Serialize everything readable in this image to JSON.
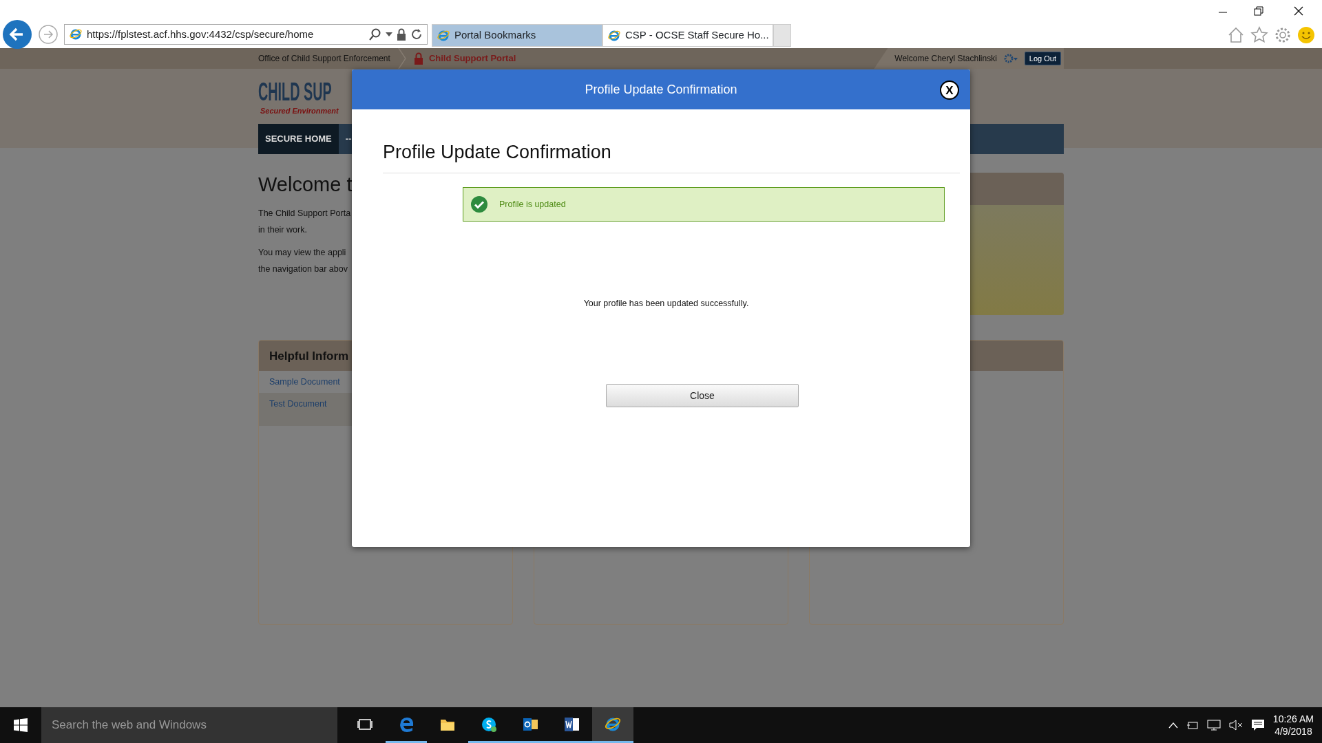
{
  "browser": {
    "address": "https://fplstest.acf.hhs.gov:4432/csp/secure/home",
    "tabs": [
      {
        "title": "Portal Bookmarks",
        "selected": false
      },
      {
        "title": "CSP - OCSE Staff Secure Ho...",
        "selected": true
      }
    ]
  },
  "top_bar": {
    "agency": "Office of Child Support Enforcement",
    "portal": "Child Support Portal",
    "welcome": "Welcome Cheryl Stachlinski",
    "logout": "Log Out"
  },
  "logo": {
    "title": "CHILD SUP",
    "subtitle": "Secured Environment"
  },
  "nav": [
    {
      "label": "SECURE HOME",
      "selected": true
    },
    {
      "label": "--",
      "selected": false
    }
  ],
  "welcome": {
    "heading": "Welcome t",
    "lines": [
      [
        "The Child Support Porta",
        "in their work."
      ],
      [
        "You may view the appli",
        "the navigation bar abov"
      ]
    ]
  },
  "helpful": {
    "title": "Helpful Inform",
    "links": [
      "Sample Document",
      "Test Document"
    ]
  },
  "modal": {
    "header": "Profile Update Confirmation",
    "close_glyph": "X",
    "title": "Profile Update Confirmation",
    "alert": "Profile is updated",
    "message": "Your profile has been updated successfully.",
    "button": "Close"
  },
  "taskbar": {
    "search_placeholder": "Search the web and Windows",
    "apps": [
      {
        "kind": "taskview",
        "running": false,
        "selected": false
      },
      {
        "kind": "edge",
        "running": true,
        "selected": false
      },
      {
        "kind": "folder",
        "running": false,
        "selected": false
      },
      {
        "kind": "skype",
        "running": true,
        "selected": false
      },
      {
        "kind": "mail",
        "running": true,
        "selected": false
      },
      {
        "kind": "word",
        "running": true,
        "selected": false
      },
      {
        "kind": "ie",
        "running": true,
        "selected": true
      }
    ],
    "time": "10:26 AM",
    "date": "4/9/2018"
  }
}
